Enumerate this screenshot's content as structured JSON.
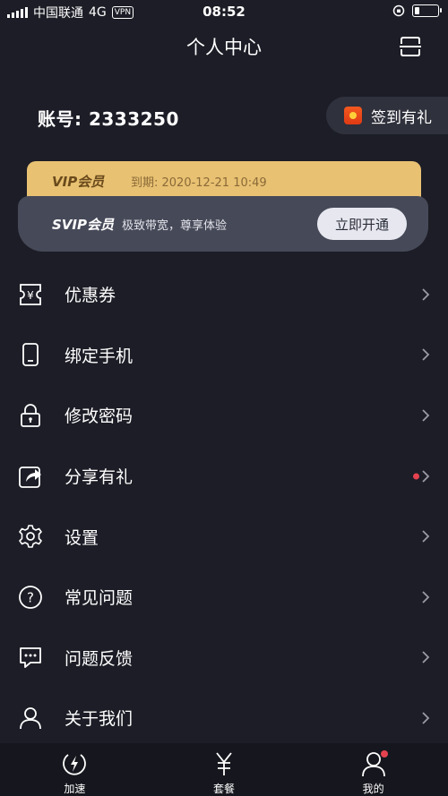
{
  "status_bar": {
    "carrier": "中国联通",
    "network": "4G",
    "vpn": "VPN",
    "time": "08:52",
    "battery_level": 0.2
  },
  "header": {
    "title": "个人中心",
    "scan_icon": "scan-icon"
  },
  "account": {
    "label": "账号: 2333250",
    "signin_label": "签到有礼",
    "signin_icon": "red-envelope-icon"
  },
  "vip": {
    "title": "VIP会员",
    "expiry": "到期: 2020-12-21 10:49",
    "color": "#e8c172"
  },
  "svip": {
    "title": "SVIP会员",
    "description": "极致带宽，尊享体验",
    "button_label": "立即开通"
  },
  "menu": [
    {
      "label": "优惠券",
      "icon": "coupon-icon"
    },
    {
      "label": "绑定手机",
      "icon": "phone-icon"
    },
    {
      "label": "修改密码",
      "icon": "lock-icon"
    },
    {
      "label": "分享有礼",
      "icon": "share-icon",
      "badge": true
    },
    {
      "label": "设置",
      "icon": "gear-icon"
    },
    {
      "label": "常见问题",
      "icon": "question-icon"
    },
    {
      "label": "问题反馈",
      "icon": "feedback-icon"
    },
    {
      "label": "关于我们",
      "icon": "user-icon"
    }
  ],
  "tabs": [
    {
      "label": "加速",
      "icon": "speed-icon"
    },
    {
      "label": "套餐",
      "icon": "yuan-icon"
    },
    {
      "label": "我的",
      "icon": "profile-icon",
      "badge": true
    }
  ],
  "colors": {
    "background": "#1c1d26",
    "accent_red": "#e5424f",
    "svip_card": "#464958"
  }
}
